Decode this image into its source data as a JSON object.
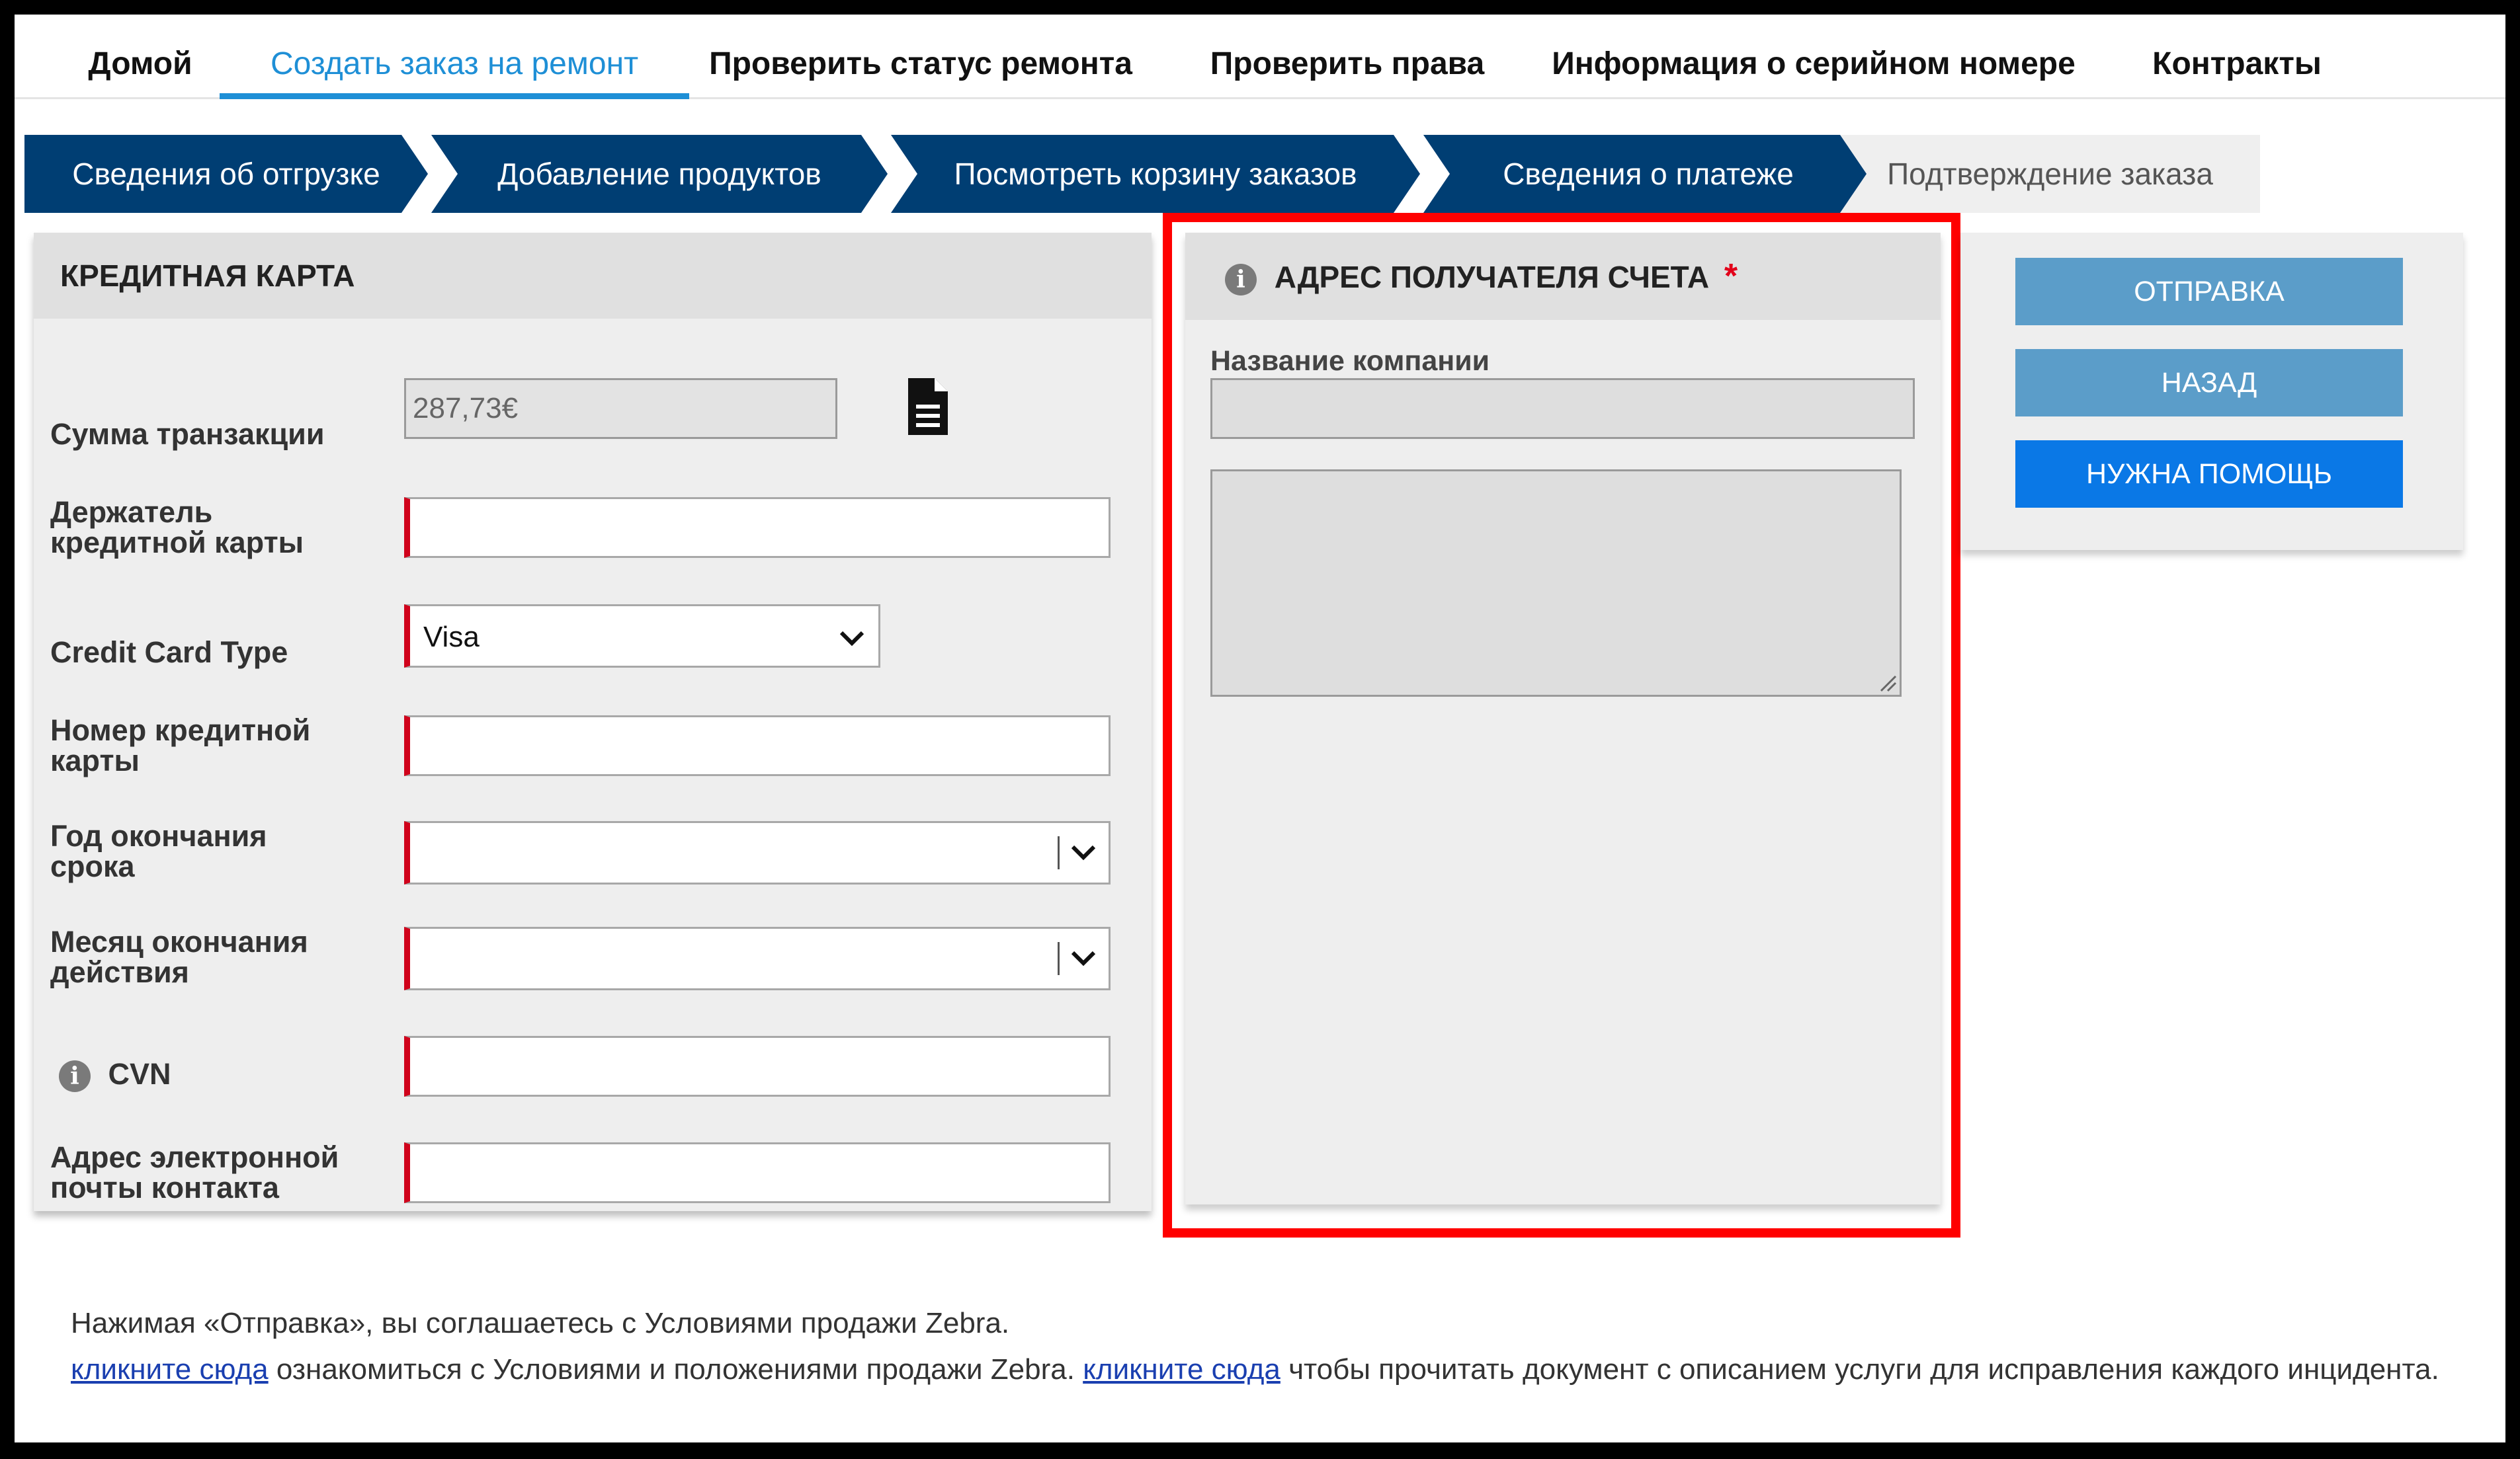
{
  "nav": {
    "items": [
      {
        "label": "Домой"
      },
      {
        "label": "Создать заказ на ремонт",
        "active": true
      },
      {
        "label": "Проверить статус ремонта"
      },
      {
        "label": "Проверить права"
      },
      {
        "label": "Информация о серийном номере"
      },
      {
        "label": "Контракты"
      }
    ]
  },
  "steps": [
    "Сведения об отгрузке",
    "Добавление продуктов",
    "Посмотреть корзину заказов",
    "Сведения о платеже",
    "Подтверждение заказа"
  ],
  "credit_card": {
    "title": "КРЕДИТНАЯ КАРТА",
    "amount_label": "Сумма транзакции",
    "amount_value": "287,73€",
    "holder_label_line1": "Держатель",
    "holder_label_line2": "кредитной карты",
    "type_label": "Credit Card Type",
    "type_value": "Visa",
    "number_label_line1": "Номер кредитной",
    "number_label_line2": "карты",
    "exp_year_label_line1": "Год окончания",
    "exp_year_label_line2": "срока",
    "exp_month_label_line1": "Месяц окончания",
    "exp_month_label_line2": "действия",
    "cvn_label": "CVN",
    "email_label_line1": "Адрес электронной",
    "email_label_line2": "почты контакта"
  },
  "billing": {
    "title": "АДРЕС ПОЛУЧАТЕЛЯ СЧЕТА",
    "required_mark": "*",
    "company_label": "Название компании"
  },
  "actions": {
    "submit": "ОТПРАВКА",
    "back": "НАЗАД",
    "help": "НУЖНА ПОМОЩЬ"
  },
  "footer": {
    "line1": "Нажимая «Отправка», вы соглашаетесь с Условиями продажи Zebra.",
    "link1": "кликните сюда",
    "text2": " ознакомиться с Условиями и положениями продажи Zebra. ",
    "link2": "кликните сюда",
    "text3": " чтобы прочитать документ с описанием услуги для исправления каждого инцидента."
  },
  "info_glyph": "i",
  "colors": {
    "nav_active": "#1e8fd6",
    "step_bg": "#003e73",
    "required_border": "#d0021b",
    "highlight": "#ff0000",
    "button_secondary": "#5b9dc9",
    "button_primary": "#0a78e6"
  }
}
